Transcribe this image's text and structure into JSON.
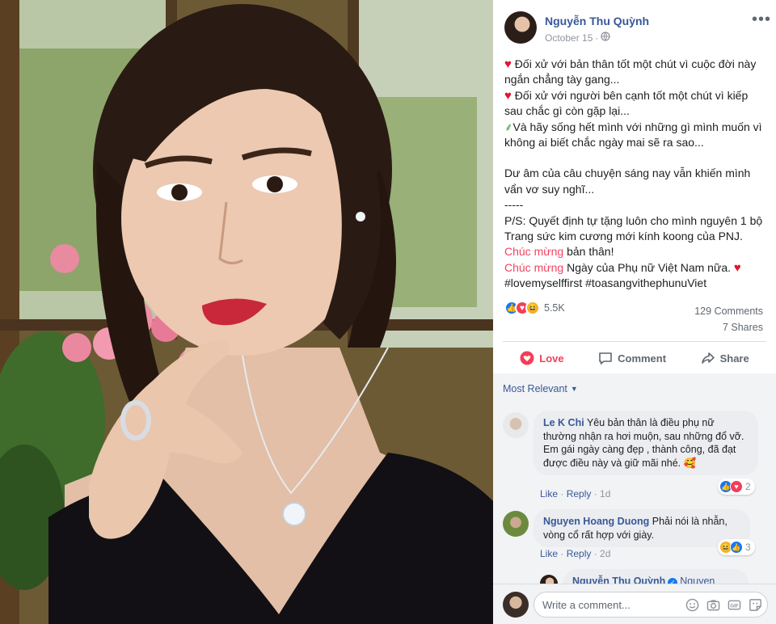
{
  "post": {
    "author": "Nguyễn Thu Quỳnh",
    "date": "October 15",
    "body": {
      "line1": "Đối xử với bản thân tốt một chút vì cuộc đời này ngắn chẳng tày gang...",
      "line2": "Đối xử với người bên cạnh tốt một chút vì kiếp sau chắc gì còn gặp lại...",
      "line3": "Và hãy sống hết mình với những gì mình muốn vì không ai biết chắc ngày mai sẽ ra sao...",
      "line4": "Dư âm của câu chuyện sáng nay vẫn khiến mình vẩn vơ suy nghĩ...",
      "dashes": "-----",
      "line5": "P/S: Quyết định tự tặng luôn cho mình nguyên 1 bộ Trang sức kim cương mới kính koong của PNJ.",
      "chuc1": "Chúc mừng",
      "line6": " bản thân!",
      "chuc2": "Chúc mừng",
      "line7": " Ngày của Phụ nữ Việt Nam nữa. ",
      "hashtags": "#lovemyselffirst #toasangvithephunuViet"
    },
    "reactions_count": "5.5K",
    "comments_count": "129 Comments",
    "shares_count": "7 Shares"
  },
  "actions": {
    "love": "Love",
    "comment": "Comment",
    "share": "Share"
  },
  "sort_label": "Most Relevant",
  "comments": [
    {
      "author": "Le K Chi",
      "text": "Yêu bản thân là điều phụ nữ thường nhận ra hơi muộn, sau những đổ vỡ. Em gái ngày càng đẹp , thành công, đã đạt được điều này và giữ mãi nhé. 🥰",
      "like": "Like",
      "reply": "Reply",
      "time": "1d",
      "reactions": "2"
    },
    {
      "author": "Nguyen Hoang Duong",
      "text": "Phải nói là nhẫn, vòng cổ rất hợp với giày.",
      "like": "Like",
      "reply": "Reply",
      "time": "2d",
      "reactions": "3"
    }
  ],
  "reply_preview": {
    "author": "Nguyễn Thu Quỳnh",
    "tag": "Nguyen"
  },
  "composer": {
    "placeholder": "Write a comment..."
  },
  "colors": {
    "link": "#385898",
    "love": "#f33e58",
    "like": "#1877f2",
    "panel_bg": "#f2f3f5"
  }
}
